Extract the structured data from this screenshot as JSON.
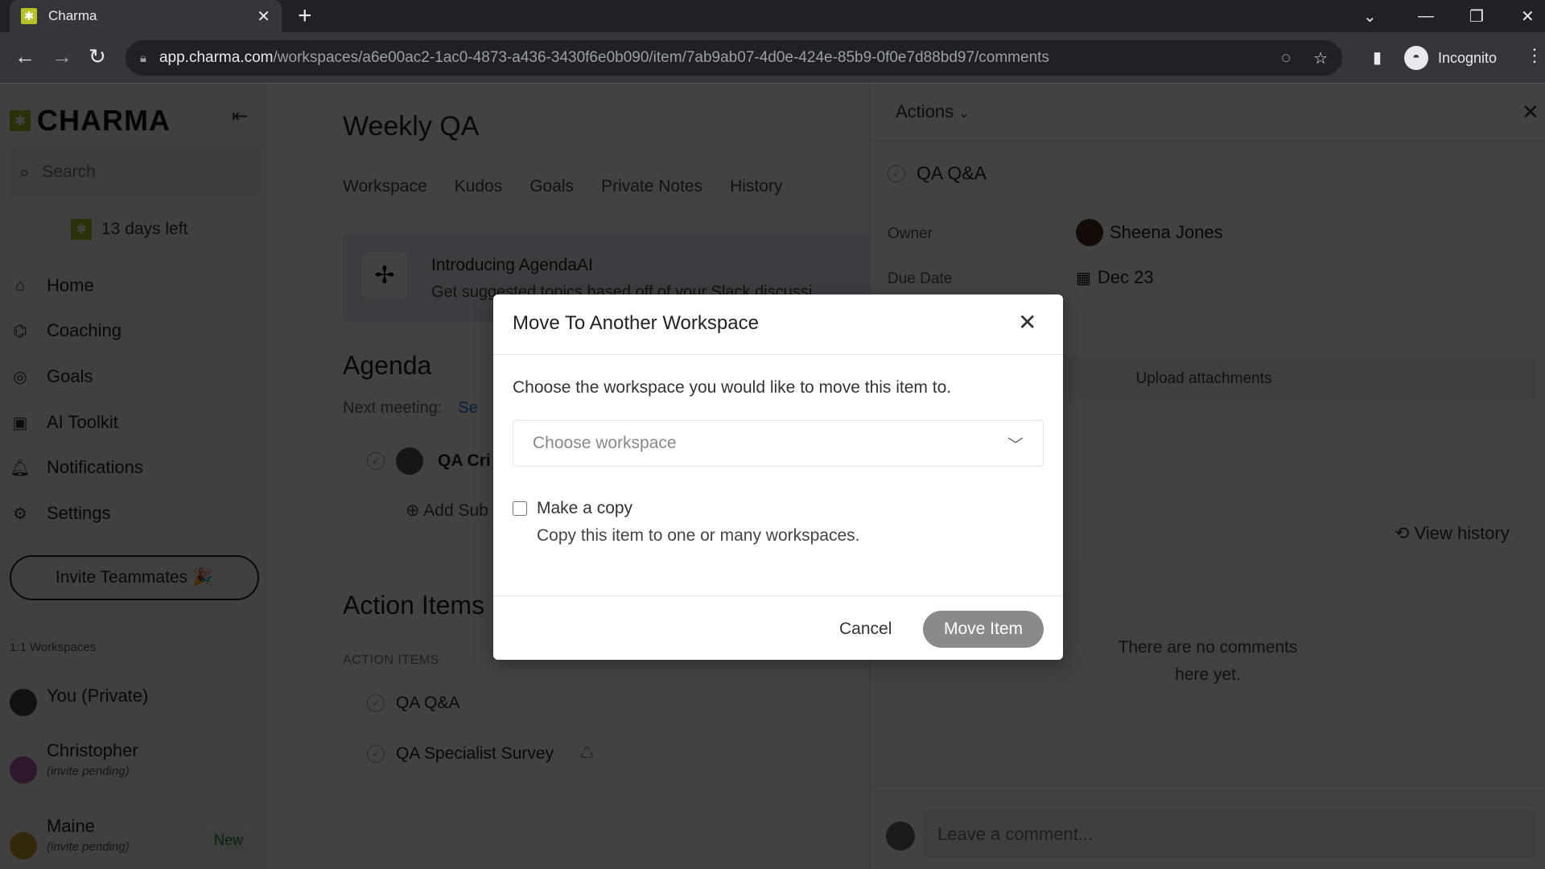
{
  "browser": {
    "tab_title": "Charma",
    "url_host": "app.charma.com",
    "url_path": "/workspaces/a6e00ac2-1ac0-4873-a436-3430f6e0b090/item/7ab9ab07-4d0e-424e-85b9-0f0e7d88bd97/comments",
    "profile_label": "Incognito"
  },
  "sidebar": {
    "logo": "CHARMA",
    "search_placeholder": "Search",
    "trial": "13 days left",
    "nav": [
      {
        "label": "Home",
        "icon": "home-icon"
      },
      {
        "label": "Coaching",
        "icon": "coaching-icon"
      },
      {
        "label": "Goals",
        "icon": "target-icon"
      },
      {
        "label": "AI Toolkit",
        "icon": "robot-icon"
      },
      {
        "label": "Notifications",
        "icon": "bell-icon"
      },
      {
        "label": "Settings",
        "icon": "gear-icon"
      }
    ],
    "invite_label": "Invite Teammates 🎉",
    "workspaces_heading": "1:1 Workspaces",
    "workspaces": [
      {
        "name": "You (Private)",
        "sub": ""
      },
      {
        "name": "Christopher",
        "sub": "(invite pending)"
      },
      {
        "name": "Maine",
        "sub": "(invite pending)",
        "badge": "New"
      }
    ]
  },
  "main": {
    "title": "Weekly QA",
    "tabs": [
      "Workspace",
      "Kudos",
      "Goals",
      "Private Notes",
      "History"
    ],
    "banner": {
      "title": "Introducing AgendaAI",
      "subtitle": "Get suggested topics based off of your Slack discussi"
    },
    "agenda": {
      "heading": "Agenda",
      "next_meeting_label": "Next meeting:",
      "next_meeting_value": "Se",
      "item": "QA Cri",
      "add_sub": "Add Sub"
    },
    "action_items": {
      "heading": "Action Items",
      "subheading": "ACTION ITEMS",
      "items": [
        "QA Q&A",
        "QA Specialist Survey"
      ]
    }
  },
  "panel": {
    "actions_label": "Actions",
    "item_title": "QA Q&A",
    "owner_label": "Owner",
    "owner_value": "Sheena Jones",
    "due_label": "Due Date",
    "due_value": "Dec 23",
    "upload_label": "Upload attachments",
    "view_history": "View history",
    "no_comments": "There are no comments",
    "no_comments_2": "here yet.",
    "comment_placeholder": "Leave a comment..."
  },
  "modal": {
    "title": "Move To Another Workspace",
    "description": "Choose the workspace you would like to move this item to.",
    "select_placeholder": "Choose workspace",
    "make_copy_label": "Make a copy",
    "make_copy_checked": false,
    "make_copy_desc": "Copy this item to one or many workspaces.",
    "cancel_label": "Cancel",
    "move_label": "Move Item"
  }
}
